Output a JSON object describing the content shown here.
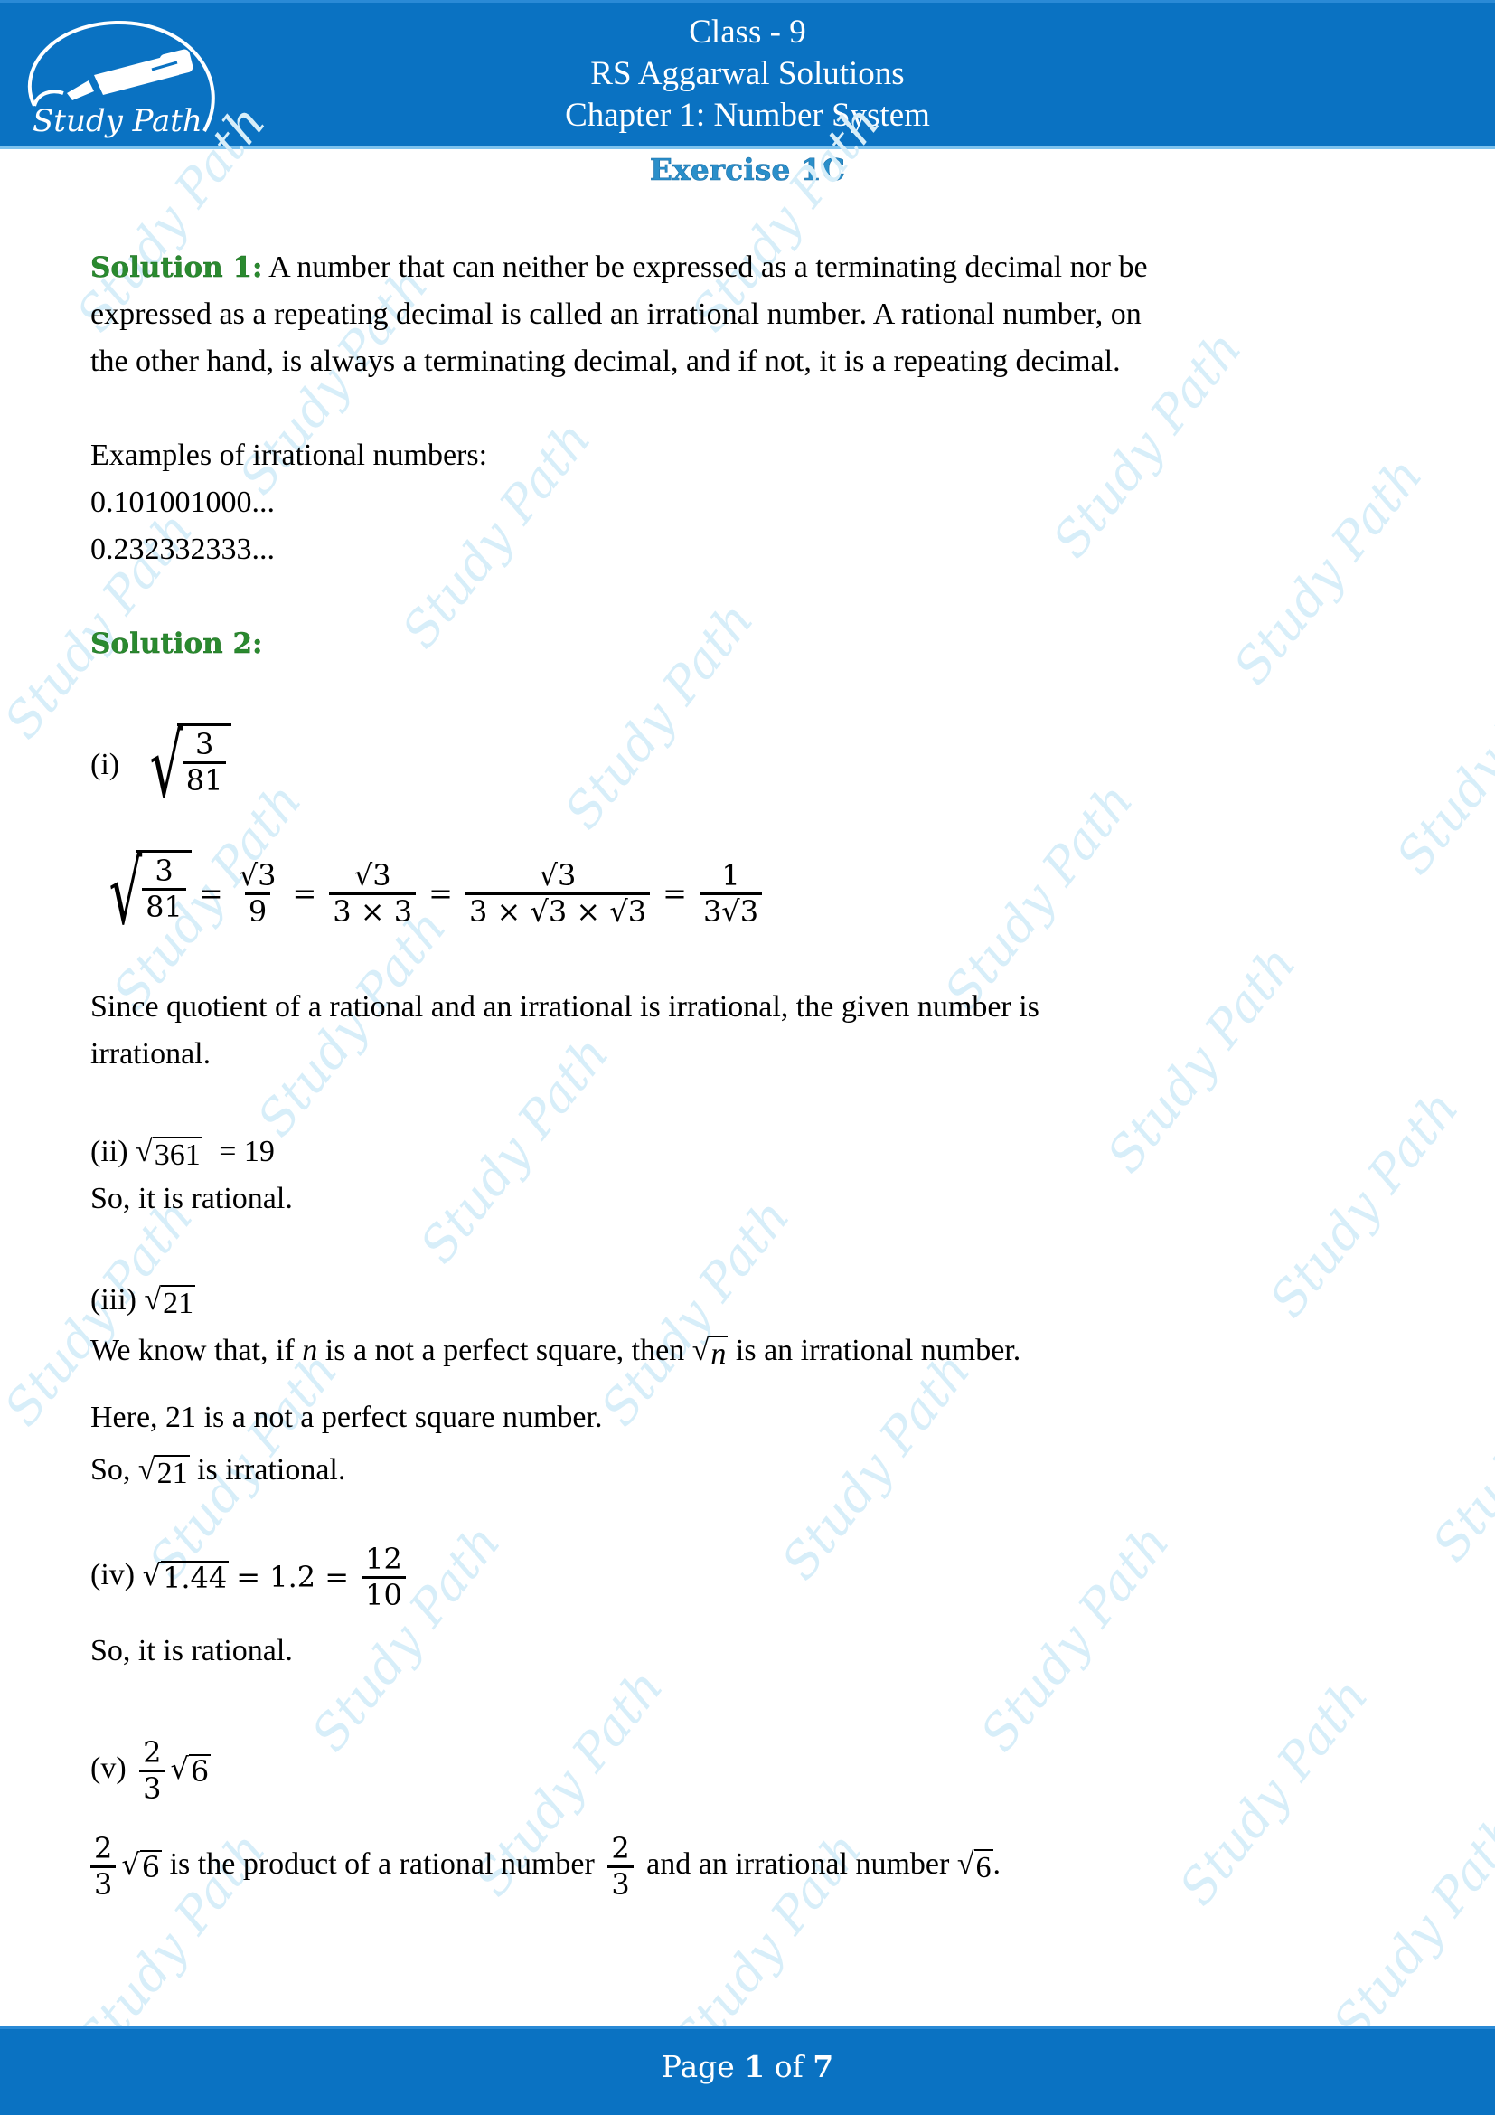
{
  "header": {
    "logo_text": "Study Path",
    "line1": "Class - 9",
    "line2": "RS Aggarwal Solutions",
    "line3": "Chapter 1: Number System"
  },
  "exercise_title": "Exercise 1C",
  "watermark_text": "Study Path",
  "solution1": {
    "label": "Solution 1:",
    "line1": " A number that can neither be expressed as a terminating decimal nor be",
    "line2": "expressed as a repeating decimal is called an irrational number. A rational number, on",
    "line3": "the other hand, is always a terminating decimal, and if not, it is a repeating decimal.",
    "examples_heading": "Examples of irrational numbers:",
    "examples": [
      "0.101001000...",
      "0.232332333..."
    ]
  },
  "solution2": {
    "label": "Solution 2:",
    "part_i": {
      "label": "(i)",
      "expr": {
        "num": "3",
        "den": "81"
      },
      "steps": [
        {
          "num": "3",
          "den": "81",
          "sqrt_whole": true
        },
        {
          "num": "√3",
          "den": "9"
        },
        {
          "num": "√3",
          "den": "3 × 3"
        },
        {
          "num": "√3",
          "den": "3 × √3 × √3"
        },
        {
          "num": "1",
          "den": "3√3"
        }
      ],
      "conclusion_line1": "Since quotient of a rational and an irrational is irrational, the given number is",
      "conclusion_line2": "irrational."
    },
    "part_ii": {
      "label": "(ii)",
      "radicand": "361",
      "result": "= 19",
      "conclusion": "So, it is rational."
    },
    "part_iii": {
      "label": "(iii)",
      "radicand": "21",
      "line1_a": "We know that, if ",
      "line1_var": "n",
      "line1_b": " is a not a perfect square, then ",
      "line1_c": " is an irrational number.",
      "line2": "Here, 21 is a not a perfect square number.",
      "line3_a": "So, ",
      "line3_b": " is irrational."
    },
    "part_iv": {
      "label": "(iv)",
      "radicand": "1.44",
      "middle": "= 1.2 =",
      "frac": {
        "num": "12",
        "den": "10"
      },
      "conclusion": "So, it is rational."
    },
    "part_v": {
      "label": "(v)",
      "frac": {
        "num": "2",
        "den": "3"
      },
      "radicand": "6",
      "text_a": " is the product of a rational number ",
      "text_b": " and an irrational number ",
      "text_end": "."
    }
  },
  "footer": {
    "prefix": "Page ",
    "current": "1",
    "middle": " of ",
    "total": "7"
  }
}
